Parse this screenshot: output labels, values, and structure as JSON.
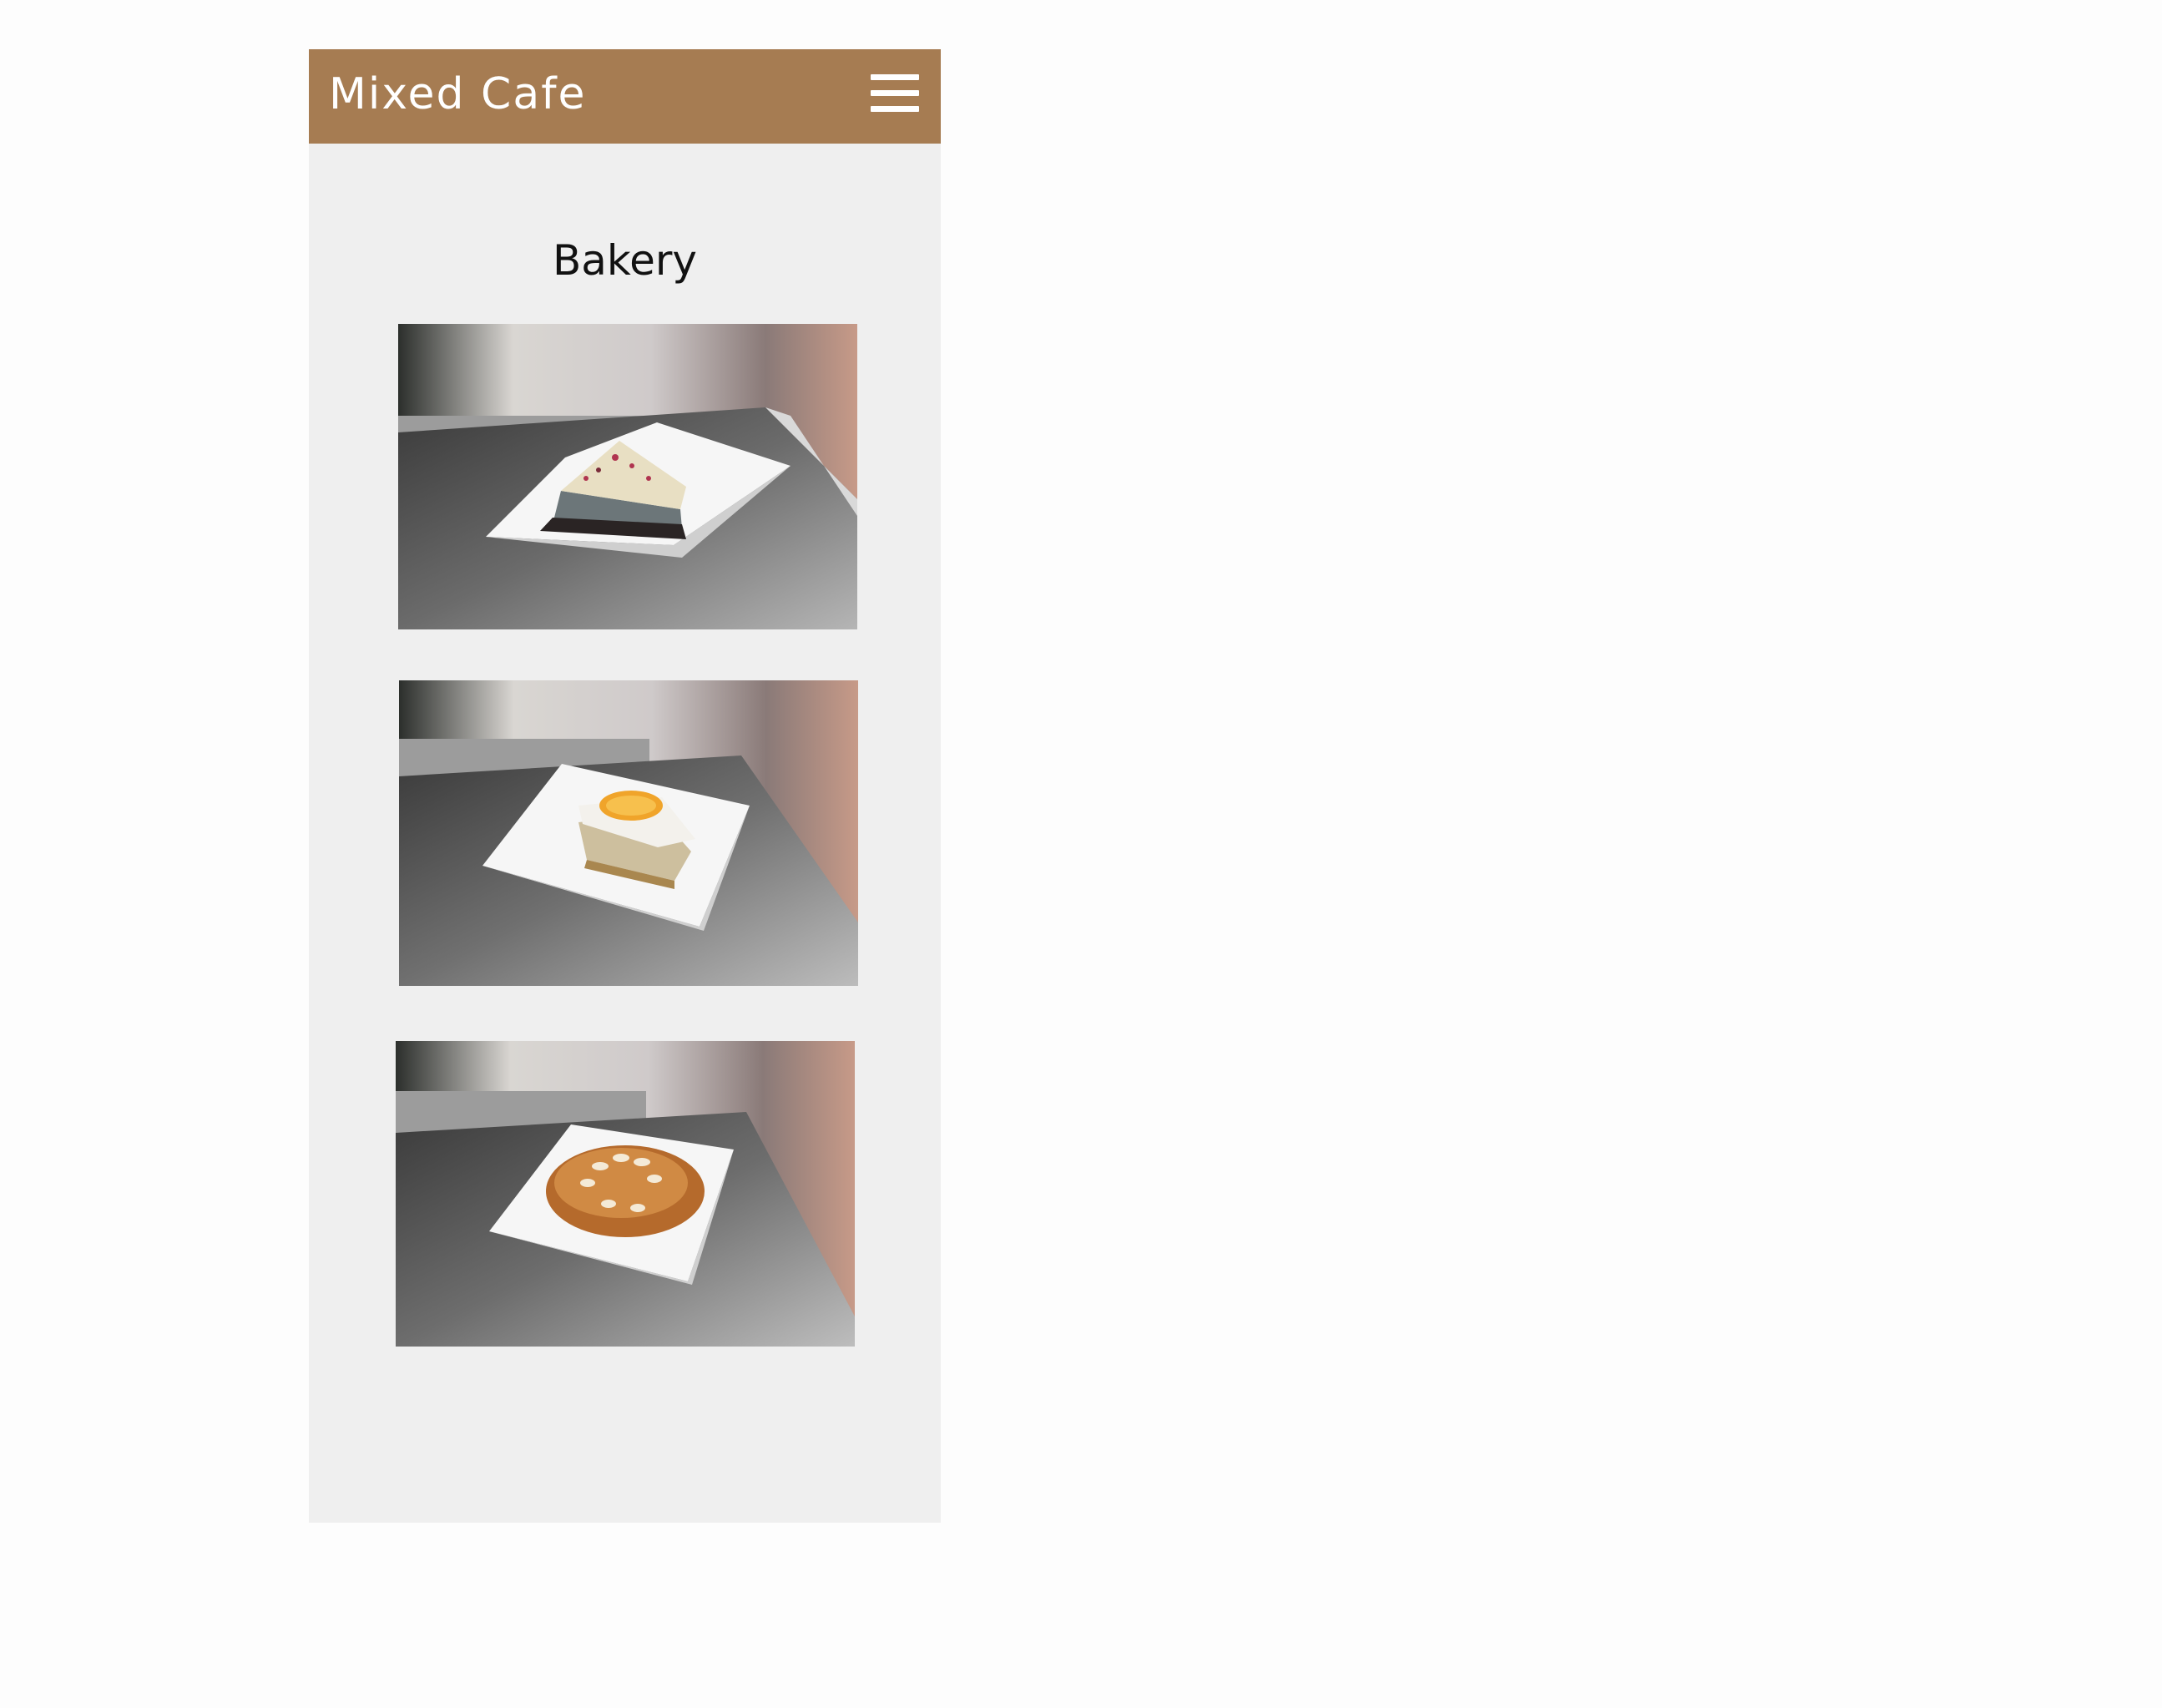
{
  "header": {
    "brand": "Mixed Cafe",
    "menu_icon": "hamburger-menu-icon",
    "background_color": "#a67c52",
    "text_color": "#ffffff"
  },
  "main": {
    "section_title": "Bakery",
    "background_color": "#efefef",
    "items": [
      {
        "image": "cheesecake-slice-photo"
      },
      {
        "image": "orange-cake-square-photo"
      },
      {
        "image": "almond-croissant-photo"
      }
    ]
  }
}
